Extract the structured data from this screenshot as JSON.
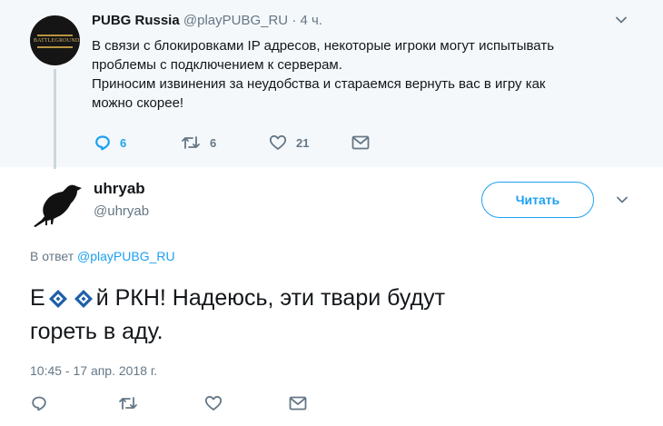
{
  "parent_tweet": {
    "name": "PUBG Russia",
    "handle": "@playPUBG_RU",
    "time": "· 4 ч.",
    "avatar_text": "BATTLEGROUNDS",
    "lines": [
      "В связи с блокировками IP адресов, некоторые игроки могут испытывать",
      "проблемы с подключением к серверам.",
      "Приносим извинения за неудобства и стараемся вернуть вас в игру как",
      "можно скорее!"
    ],
    "reply_count": "6",
    "retweet_count": "6",
    "like_count": "21"
  },
  "reply_tweet": {
    "name": "uhryab",
    "handle": "@uhryab",
    "follow_label": "Читать",
    "reply_to_prefix": "В ответ",
    "reply_to_mention": "@playPUBG_RU",
    "text_start": "Е",
    "text_rest_line1": "й РКН! Надеюсь, эти твари будут",
    "text_line2": "гореть в аду.",
    "timestamp": "10:45 - 17 апр. 2018 г."
  },
  "colors": {
    "accent": "#1da1f2",
    "secondary_text": "#657786",
    "parent_bg": "#f5f8fa",
    "rkn_blue": "#1f5fa8"
  }
}
